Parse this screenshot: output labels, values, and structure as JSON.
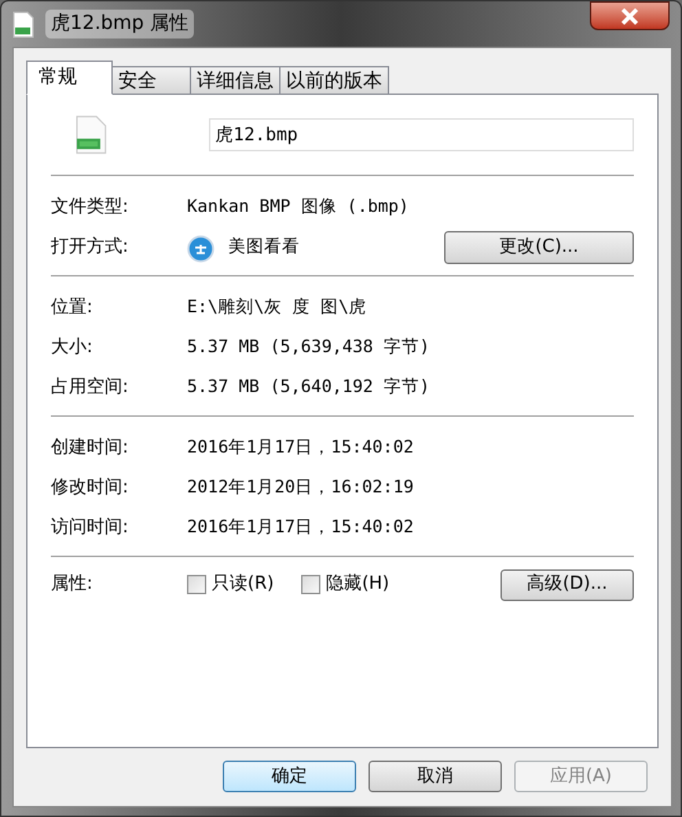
{
  "window": {
    "title": "虎12.bmp 属性"
  },
  "tabs": [
    {
      "label": "常规",
      "selected": true
    },
    {
      "label": "安全",
      "selected": false
    },
    {
      "label": "详细信息",
      "selected": false
    },
    {
      "label": "以前的版本",
      "selected": false
    }
  ],
  "file_name": {
    "value": "虎12.bmp"
  },
  "sections": [
    [
      {
        "label": "文件类型:",
        "value": "Kankan BMP 图像 (.bmp)"
      },
      {
        "label": "打开方式:",
        "value": "美图看看",
        "app_icon": true,
        "button": "更改(C)..."
      }
    ],
    [
      {
        "label": "位置:",
        "value": "E:\\雕刻\\灰 度 图\\虎"
      },
      {
        "label": "大小:",
        "value": "5.37 MB (5,639,438 字节)"
      },
      {
        "label": "占用空间:",
        "value": "5.37 MB (5,640,192 字节)"
      }
    ],
    [
      {
        "label": "创建时间:",
        "value": "2016年1月17日，15:40:02"
      },
      {
        "label": "修改时间:",
        "value": "2012年1月20日，16:02:19"
      },
      {
        "label": "访问时间:",
        "value": "2016年1月17日，15:40:02"
      }
    ]
  ],
  "attributes": {
    "label": "属性:",
    "checkboxes": [
      {
        "label": "只读(R)",
        "checked": false
      },
      {
        "label": "隐藏(H)",
        "checked": false
      }
    ],
    "button": "高级(D)..."
  },
  "buttons": [
    {
      "label": "确定",
      "default": true,
      "disabled": false
    },
    {
      "label": "取消",
      "default": false,
      "disabled": false
    },
    {
      "label": "应用(A)",
      "default": false,
      "disabled": true
    }
  ]
}
